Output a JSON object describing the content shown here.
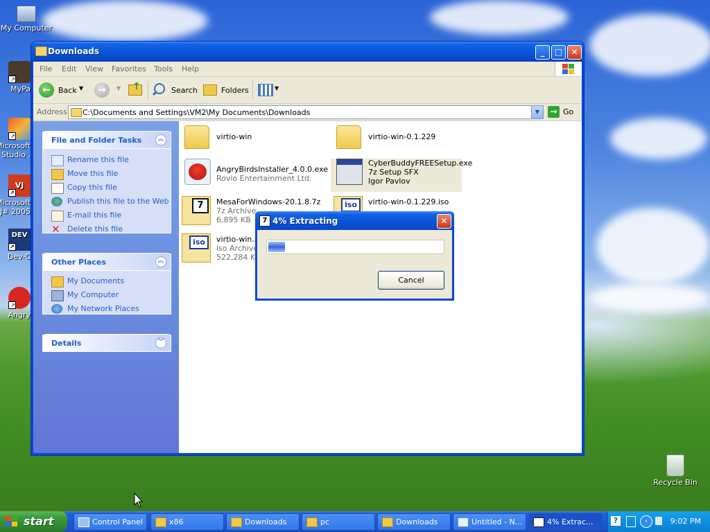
{
  "desktop": {
    "icons": [
      {
        "label": "My Computer"
      },
      {
        "label": "MyPa"
      },
      {
        "label": "Microsoft Studio ."
      },
      {
        "label": "Microsoft J# 2005"
      },
      {
        "label": "Dev-C"
      },
      {
        "label": "Angry"
      },
      {
        "label": "Recycle Bin"
      }
    ]
  },
  "explorer": {
    "title": "Downloads",
    "menu": [
      "File",
      "Edit",
      "View",
      "Favorites",
      "Tools",
      "Help"
    ],
    "toolbar": {
      "back": "Back",
      "search": "Search",
      "folders": "Folders"
    },
    "address": {
      "label": "Address",
      "path": "C:\\Documents and Settings\\VM2\\My Documents\\Downloads",
      "go": "Go"
    },
    "tasks": {
      "title": "File and Folder Tasks",
      "items": [
        "Rename this file",
        "Move this file",
        "Copy this file",
        "Publish this file to the Web",
        "E-mail this file",
        "Delete this file"
      ]
    },
    "places": {
      "title": "Other Places",
      "items": [
        "My Documents",
        "My Computer",
        "My Network Places"
      ]
    },
    "details": {
      "title": "Details"
    },
    "files": [
      {
        "name": "virtio-win",
        "line2": "",
        "line3": ""
      },
      {
        "name": "virtio-win-0.1.229",
        "line2": "",
        "line3": ""
      },
      {
        "name": "AngryBirdsInstaller_4.0.0.exe",
        "line2": "Rovio Entertainment Ltd.",
        "line3": ""
      },
      {
        "name": "CyberBuddyFREESetup.exe",
        "line2": "7z Setup SFX",
        "line3": "Igor Pavlov"
      },
      {
        "name": "MesaForWindows-20.1.8.7z",
        "line2": "7z Archive",
        "line3": "6,895 KB"
      },
      {
        "name": "virtio-win-0.1.229.iso",
        "line2": "",
        "line3": ""
      },
      {
        "name": "virtio-win.iso",
        "line2": "iso Archive",
        "line3": "522,284 KB"
      }
    ]
  },
  "dialog": {
    "title": "4% Extracting",
    "progress": 0.04,
    "cancel": "Cancel"
  },
  "taskbar": {
    "start": "start",
    "tasks": [
      "Control Panel",
      "x86",
      "Downloads",
      "pc",
      "Downloads",
      "Untitled - N...",
      "4% Extrac..."
    ],
    "clock": "9:02 PM"
  }
}
